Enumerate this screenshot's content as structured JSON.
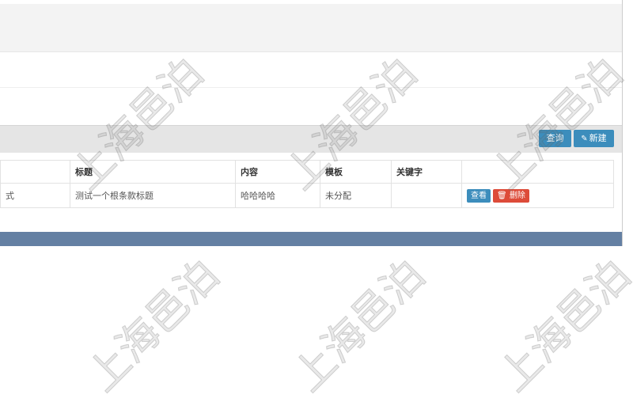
{
  "toolbar": {
    "query_label": "查询",
    "new_label": "新建"
  },
  "table": {
    "headers": [
      "",
      "标题",
      "内容",
      "模板",
      "关键字",
      ""
    ],
    "rows": [
      {
        "col0": "式",
        "title": "测试一个根条款标题",
        "content": "哈哈哈哈",
        "template": "未分配",
        "keywords": "",
        "view_label": "查看",
        "delete_label": "删除"
      }
    ]
  },
  "watermark": "上海邑泊",
  "colors": {
    "primary": "#3c8dbc",
    "danger": "#dd4b39",
    "footer": "#6480a3"
  }
}
